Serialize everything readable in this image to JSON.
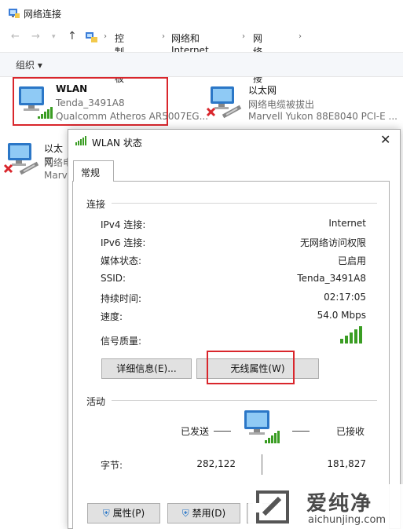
{
  "window": {
    "title": "网络连接",
    "breadcrumb": [
      "控制面板",
      "网络和 Internet",
      "网络连接"
    ],
    "organize_label": "组织 ▾"
  },
  "adapters": [
    {
      "name": "WLAN",
      "network": "Tenda_3491A8",
      "device": "Qualcomm Atheros AR5007EG...",
      "status": "connected"
    },
    {
      "name": "以太网",
      "network": "网络电缆被拔出",
      "device": "Marvell Yukon 88E8040 PCI-E ...",
      "status": "unplugged"
    },
    {
      "name": "以太网",
      "network": "网络电",
      "device": "Marv",
      "status": "unplugged"
    }
  ],
  "dialog": {
    "title": "WLAN 状态",
    "tab": "常规",
    "connection_group": "连接",
    "rows": [
      {
        "label": "IPv4 连接:",
        "value": "Internet"
      },
      {
        "label": "IPv6 连接:",
        "value": "无网络访问权限"
      },
      {
        "label": "媒体状态:",
        "value": "已启用"
      },
      {
        "label": "SSID:",
        "value": "Tenda_3491A8"
      },
      {
        "label": "持续时间:",
        "value": "02:17:05"
      },
      {
        "label": "速度:",
        "value": "54.0 Mbps"
      }
    ],
    "signal_label": "信号质量:",
    "signal_bars": 5,
    "details_button": "详细信息(E)...",
    "wireless_props_button": "无线属性(W)",
    "activity_group": "活动",
    "sent_label": "已发送",
    "received_label": "已接收",
    "bytes_label": "字节:",
    "bytes_sent": "282,122",
    "bytes_received": "181,827",
    "properties_button": "属性(P)",
    "disable_button": "禁用(D)"
  },
  "watermark": {
    "brand": "爱纯净",
    "url": "aichunjing.com"
  },
  "colors": {
    "highlight": "#d9262c",
    "signal": "#3a9d23",
    "monitor": "#2b77c7"
  }
}
